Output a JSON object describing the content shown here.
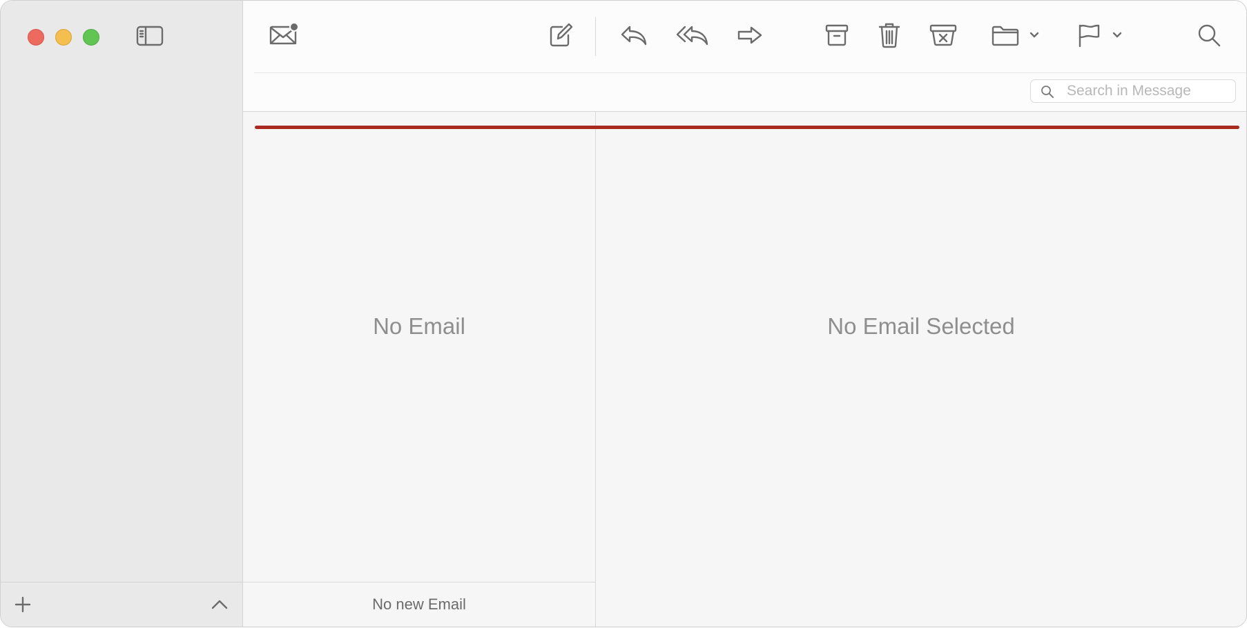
{
  "window": {
    "controls": [
      "close",
      "minimize",
      "zoom"
    ],
    "accent_color": "#a82a21"
  },
  "sidebar": {
    "toggle_icon": "sidebar-toggle-icon",
    "footer": {
      "add_icon": "plus-icon",
      "collapse_icon": "chevron-up-icon"
    }
  },
  "toolbar": {
    "icons": [
      "get-mail-icon",
      "compose-icon",
      "reply-icon",
      "reply-all-icon",
      "forward-icon",
      "archive-icon",
      "trash-icon",
      "junk-icon",
      "move-folder-icon",
      "flag-icon",
      "search-icon"
    ],
    "search": {
      "placeholder": "Search in Message",
      "value": ""
    }
  },
  "message_list": {
    "empty_text": "No Email",
    "footer_text": "No new Email"
  },
  "viewer": {
    "empty_text": "No Email Selected"
  }
}
